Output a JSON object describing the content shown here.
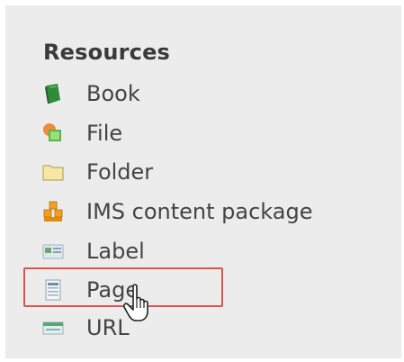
{
  "section": {
    "title": "Resources"
  },
  "items": [
    {
      "label": "Book",
      "icon": "book-icon"
    },
    {
      "label": "File",
      "icon": "file-icon"
    },
    {
      "label": "Folder",
      "icon": "folder-icon"
    },
    {
      "label": "IMS content package",
      "icon": "ims-package-icon"
    },
    {
      "label": "Label",
      "icon": "label-icon"
    },
    {
      "label": "Page",
      "icon": "page-icon"
    },
    {
      "label": "URL",
      "icon": "url-icon"
    }
  ],
  "highlighted_item": "Page",
  "colors": {
    "highlight_border": "#d9534f",
    "panel_background": "#ececec",
    "text": "#444444"
  }
}
